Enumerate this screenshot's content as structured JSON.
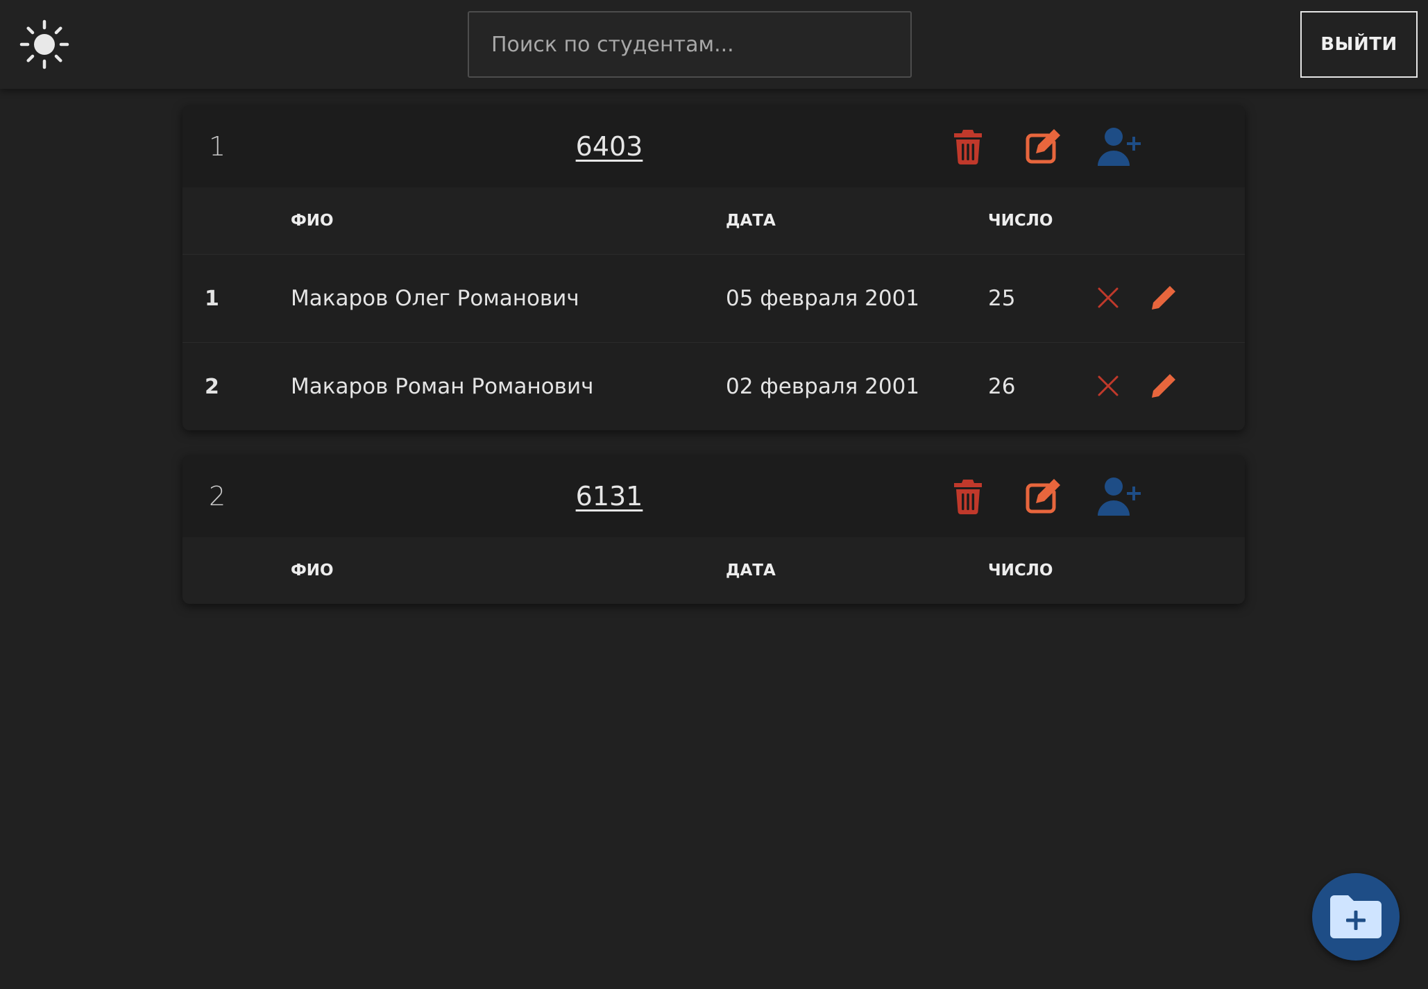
{
  "header": {
    "search_placeholder": "Поиск по студентам...",
    "logout_label": "ВЫЙТИ"
  },
  "columns": {
    "fio": "ФИО",
    "date": "ДАТА",
    "number": "ЧИСЛО"
  },
  "groups": [
    {
      "index": "1",
      "name": "6403",
      "students": [
        {
          "num": "1",
          "fio": "Макаров Олег Романович",
          "date": "05 февраля 2001",
          "number": "25"
        },
        {
          "num": "2",
          "fio": "Макаров Роман Романович",
          "date": "02 февраля 2001",
          "number": "26"
        }
      ]
    },
    {
      "index": "2",
      "name": "6131",
      "students": []
    }
  ],
  "icons": {
    "theme": "sun-icon",
    "group_delete": "trash-icon",
    "group_edit": "edit-icon",
    "group_add_student": "user-plus-icon",
    "row_remove": "close-icon",
    "row_edit": "pencil-icon",
    "fab": "folder-plus-icon"
  },
  "colors": {
    "background": "#212121",
    "delete_red": "#c0392b",
    "edit_orange": "#e8663d",
    "add_blue": "#1e4d86",
    "fab_blue": "#1e4d86",
    "fab_icon": "#cfe4ff"
  }
}
